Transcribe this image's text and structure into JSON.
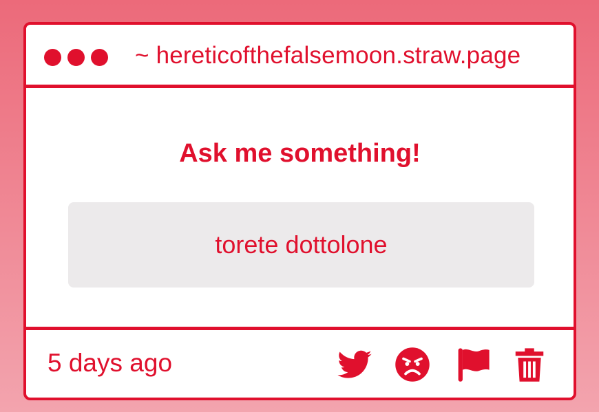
{
  "window": {
    "url": "~ hereticofthefalsemoon.straw.page"
  },
  "main": {
    "heading": "Ask me something!",
    "question": "torete dottolone"
  },
  "footer": {
    "timestamp": "5 days ago",
    "actions": [
      "twitter-icon",
      "angry-face-icon",
      "flag-icon",
      "trash-icon"
    ]
  },
  "colors": {
    "accent": "#e0102d",
    "question_background": "#eceaeb",
    "page_gradient_top": "#ec6a7a",
    "page_gradient_bottom": "#f3a4ae"
  }
}
